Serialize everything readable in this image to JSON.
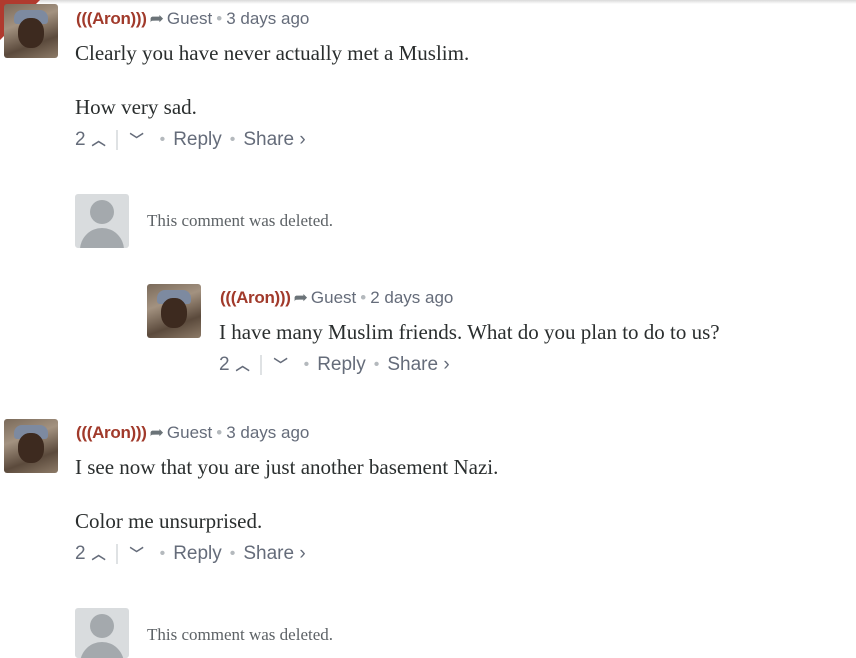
{
  "comments": [
    {
      "author": "(((Aron)))",
      "via": "Guest",
      "time": "3 days ago",
      "paragraphs": [
        "Clearly you have never actually met a Muslim.",
        "How very sad."
      ],
      "votes": "2",
      "reply": "Reply",
      "share": "Share ›"
    },
    {
      "deleted_text": "This comment was deleted."
    },
    {
      "author": "(((Aron)))",
      "via": "Guest",
      "time": "2 days ago",
      "paragraphs": [
        "I have many Muslim friends. What do you plan to do to us?"
      ],
      "votes": "2",
      "reply": "Reply",
      "share": "Share ›"
    },
    {
      "author": "(((Aron)))",
      "via": "Guest",
      "time": "3 days ago",
      "paragraphs": [
        "I see now that you are just another basement Nazi.",
        "Color me unsurprised."
      ],
      "votes": "2",
      "reply": "Reply",
      "share": "Share ›"
    },
    {
      "deleted_text": "This comment was deleted."
    }
  ],
  "icons": {
    "reply_arrow": "arrow-right-curved-icon",
    "upvote": "chevron-up-icon",
    "downvote": "chevron-down-icon"
  },
  "colors": {
    "author": "#a13a2b",
    "meta": "#656c7a",
    "text": "#2a2e2e"
  }
}
